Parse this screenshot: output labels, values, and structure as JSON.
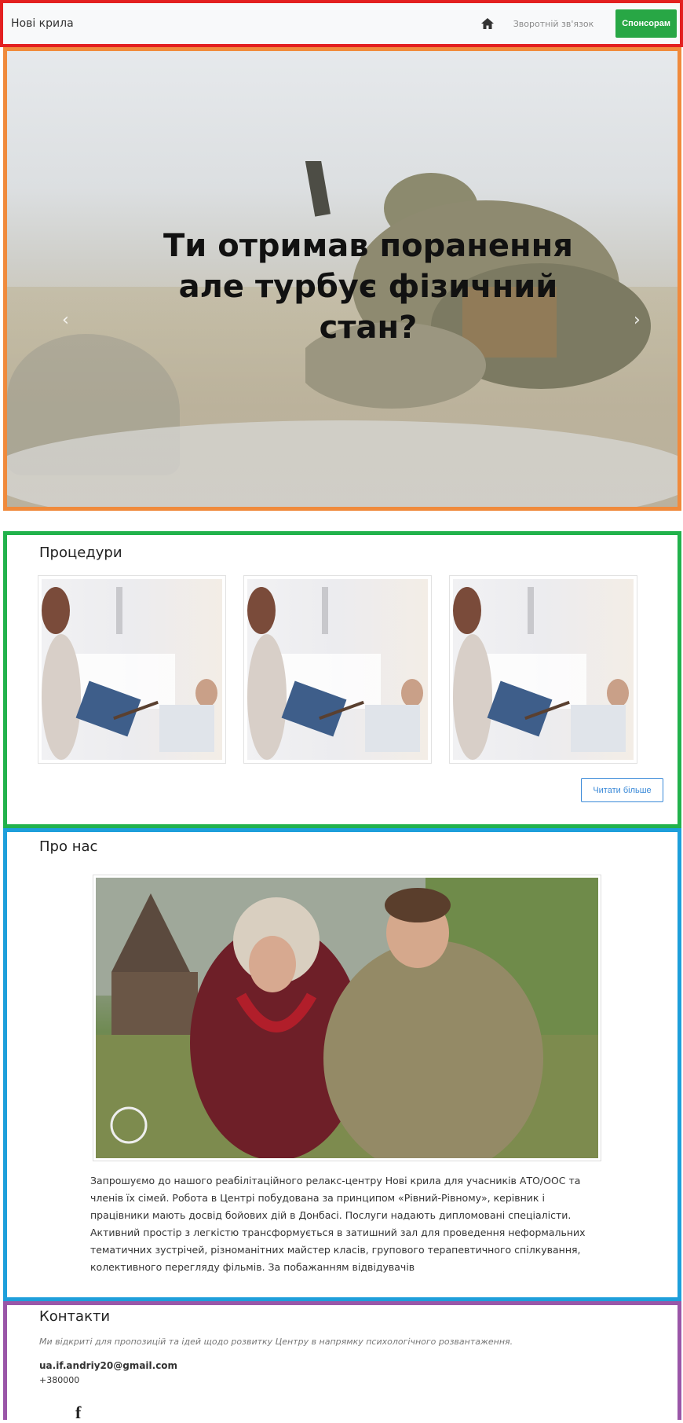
{
  "navbar": {
    "brand": "Нові крила",
    "home_icon": "home-icon",
    "feedback_link": "Зворотній зв'язок",
    "sponsor_button": "Спонсорам",
    "sponsor_color": "#28a745"
  },
  "hero": {
    "title_line1": "Ти отримав поранення",
    "title_line2": "але турбує фізичний",
    "title_line3": "стан?",
    "prev_icon": "chevron-left-icon",
    "next_icon": "chevron-right-icon"
  },
  "procedures": {
    "title": "Процедури",
    "read_more": "Читати більше"
  },
  "about": {
    "title": "Про нас",
    "text": "Запрошуємо до нашого реабілітаційного релакс-центру Нові крила для учасників АТО/ООС та членів їх сімей. Робота в Центрі побудована за принципом «Рівний-Рівному», керівник і працівники мають досвід бойових дій в Донбасі. Послуги надають дипломовані спеціалісти. Активний простір з легкістю трансформується в затишний зал для проведення неформальних тематичних зустрічей, різноманітних майстер класів, групового терапевтичного спілкування, колективного перегляду фільмів. За побажанням відвідувачів"
  },
  "contacts": {
    "title": "Контакти",
    "subtitle": "Ми відкриті для пропозицій та ідей щодо розвитку Центру в напрямку психологічного розвантаження.",
    "email": "ua.if.andriy20@gmail.com",
    "phone": "+380000",
    "facebook_icon": "facebook-icon"
  }
}
